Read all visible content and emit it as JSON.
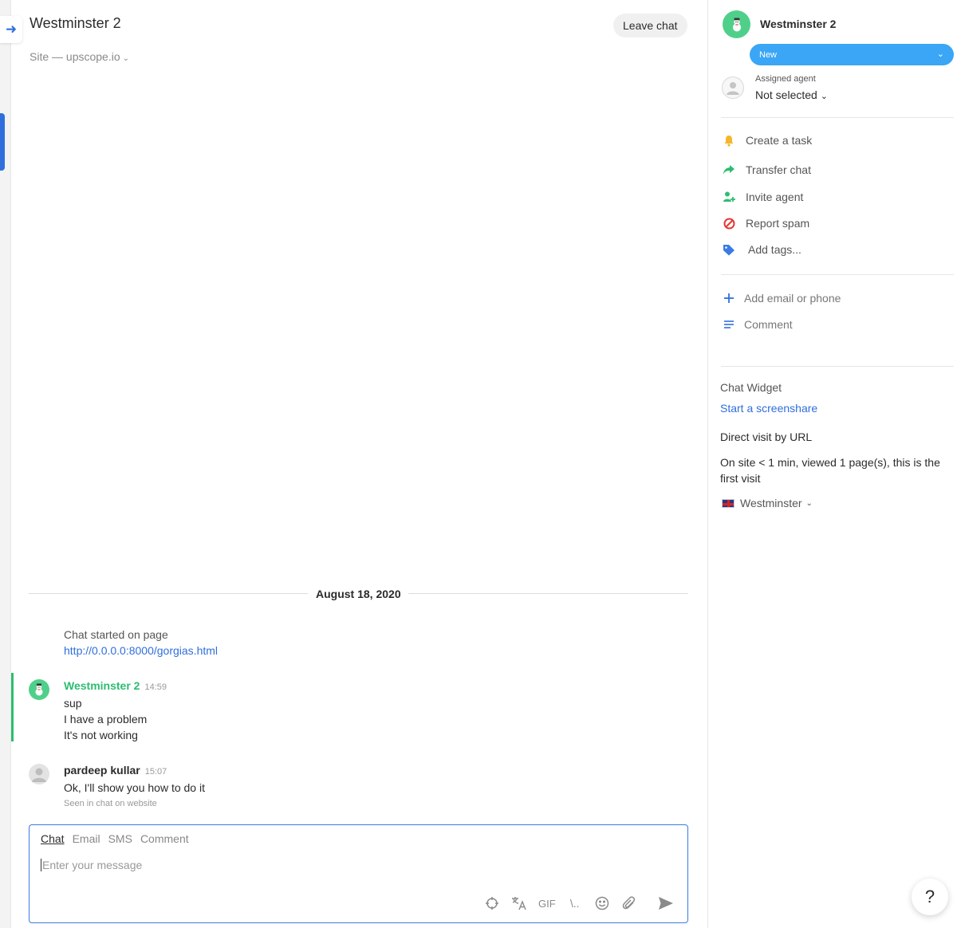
{
  "header": {
    "title": "Westminster 2",
    "site": "Site — upscope.io",
    "leave_label": "Leave chat"
  },
  "divider": {
    "date": "August 18, 2020"
  },
  "started": {
    "text": "Chat started on page",
    "url": "http://0.0.0.0:8000/gorgias.html"
  },
  "messages": [
    {
      "name": "Westminster 2",
      "time": "14:59",
      "lines": [
        "sup",
        "I have a problem",
        "It's not working"
      ]
    },
    {
      "name": "pardeep kullar",
      "time": "15:07",
      "lines": [
        "Ok, I'll show you how to do it"
      ],
      "seen": "Seen in chat on website"
    }
  ],
  "composer": {
    "tabs": [
      "Chat",
      "Email",
      "SMS",
      "Comment"
    ],
    "placeholder": "Enter your message",
    "gif_label": "GIF",
    "shortcut_label": "\\.."
  },
  "panel": {
    "name": "Westminster 2",
    "status": "New",
    "assigned_label": "Assigned agent",
    "assigned_value": "Not selected",
    "actions": [
      "Create a task",
      "Transfer chat",
      "Invite agent",
      "Report spam",
      "Add tags..."
    ],
    "extras": [
      "Add email or phone",
      "Comment"
    ],
    "widget_title": "Chat Widget",
    "screenshare_link": "Start a screenshare",
    "visit": "Direct visit by URL",
    "visit_info": "On site < 1 min, viewed 1 page(s), this is the first visit",
    "location": "Westminster"
  },
  "help_label": "?",
  "colors": {
    "accent": "#2f6fdc",
    "status": "#3aa6f5",
    "visitor": "#2dbd71",
    "bell": "#f5b62b",
    "transfer": "#2dbd71",
    "invite": "#2dbd71",
    "spam": "#e53935",
    "tag": "#3b7be3"
  }
}
